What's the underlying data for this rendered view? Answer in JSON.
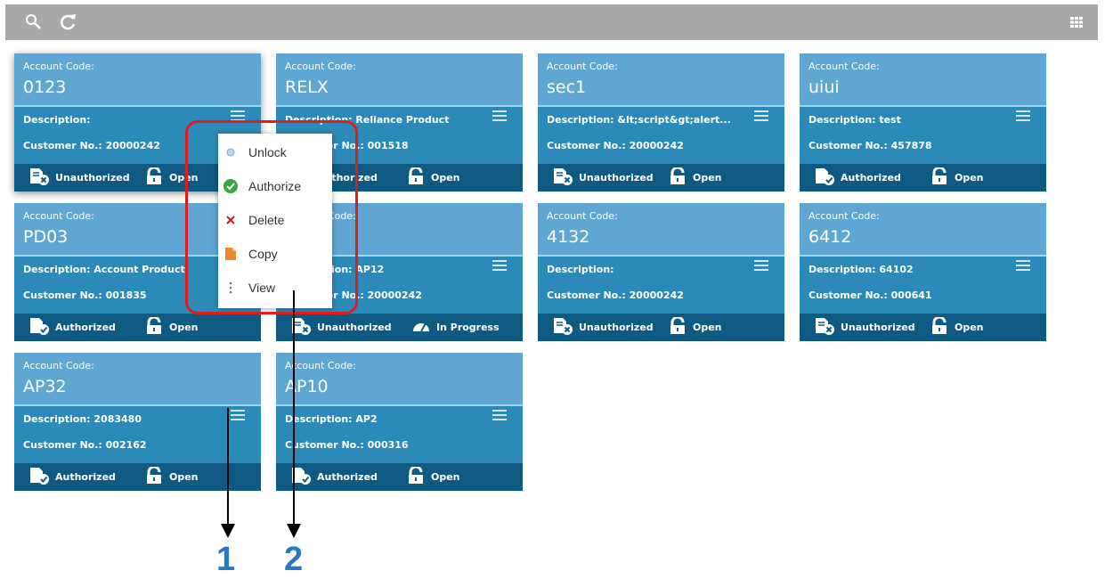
{
  "toolbar": {
    "icons": [
      "search-icon",
      "refresh-icon",
      "grid-view-icon"
    ]
  },
  "labels": {
    "account_code": "Account Code:",
    "description": "Description:",
    "customer_no": "Customer No.:"
  },
  "cards": [
    {
      "code": "0123",
      "description": "",
      "customer": "20000242",
      "auth": "Unauthorized",
      "status": "Open"
    },
    {
      "code": "RELX",
      "description": "Reliance Product",
      "customer": "001518",
      "auth": "Authorized",
      "status": "Open"
    },
    {
      "code": "sec1",
      "description": "&lt;script&gt;alert...",
      "customer": "20000242",
      "auth": "Unauthorized",
      "status": "Open"
    },
    {
      "code": "uiui",
      "description": "test",
      "customer": "457878",
      "auth": "Authorized",
      "status": "Open"
    },
    {
      "code": "PD03",
      "description": "Account Product",
      "customer": "001835",
      "auth": "Authorized",
      "status": "Open"
    },
    {
      "code": "",
      "description": "AP12",
      "customer": "20000242",
      "auth": "Unauthorized",
      "status": "In Progress"
    },
    {
      "code": "4132",
      "description": "",
      "customer": "20000242",
      "auth": "Unauthorized",
      "status": "Open"
    },
    {
      "code": "6412",
      "description": "64102",
      "customer": "000641",
      "auth": "Unauthorized",
      "status": "Open"
    },
    {
      "code": "AP32",
      "description": "2083480",
      "customer": "002162",
      "auth": "Authorized",
      "status": "Open"
    },
    {
      "code": "AP10",
      "description": "AP2",
      "customer": "000316",
      "auth": "Authorized",
      "status": "Open"
    }
  ],
  "context_menu": {
    "items": [
      {
        "label": "Unlock",
        "icon": "unlock-icon"
      },
      {
        "label": "Authorize",
        "icon": "authorize-check-icon"
      },
      {
        "label": "Delete",
        "icon": "delete-x-icon"
      },
      {
        "label": "Copy",
        "icon": "copy-icon"
      },
      {
        "label": "View",
        "icon": "view-dots-icon"
      }
    ]
  },
  "callouts": {
    "one": "1",
    "two": "2"
  },
  "colors": {
    "highlight": "#e01d1d",
    "callout": "#2a78bf",
    "card_body": "#2b8ab8",
    "card_head": "#5fa6d3",
    "card_foot": "#0e5a82"
  }
}
